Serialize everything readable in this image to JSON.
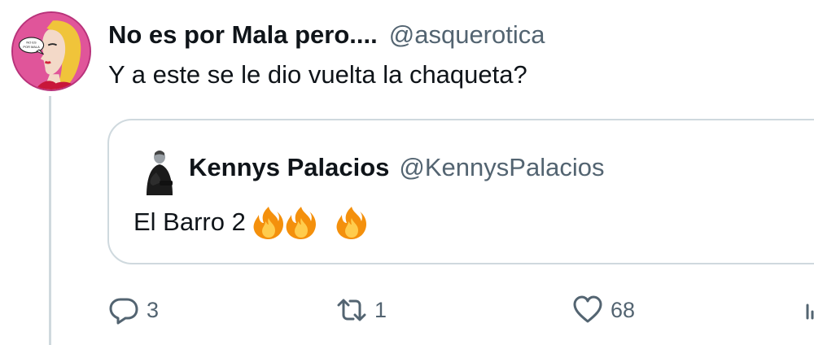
{
  "tweet": {
    "author_name": "No es por Mala pero....",
    "author_handle": "@asquerotica",
    "text": "Y a este se le dio vuelta la chaqueta?",
    "avatar_icon": "cartoon-woman-avatar",
    "avatar_speech_text": "NO ES POR MALA",
    "avatar_bg": "#e0559a"
  },
  "quoted": {
    "author_name": "Kennys Palacios",
    "author_handle": "@KennysPalacios",
    "text": "El Barro 2",
    "emojis": [
      "fire",
      "fire",
      "fire"
    ],
    "avatar_icon": "person-avatar"
  },
  "actions": {
    "reply_count": "3",
    "retweet_count": "1",
    "like_count": "68",
    "reply_icon": "reply-icon",
    "retweet_icon": "retweet-icon",
    "like_icon": "heart-icon",
    "share_icon": "share-icon"
  },
  "colors": {
    "text": "#0f1419",
    "secondary": "#536471",
    "border": "#cfd9de"
  }
}
